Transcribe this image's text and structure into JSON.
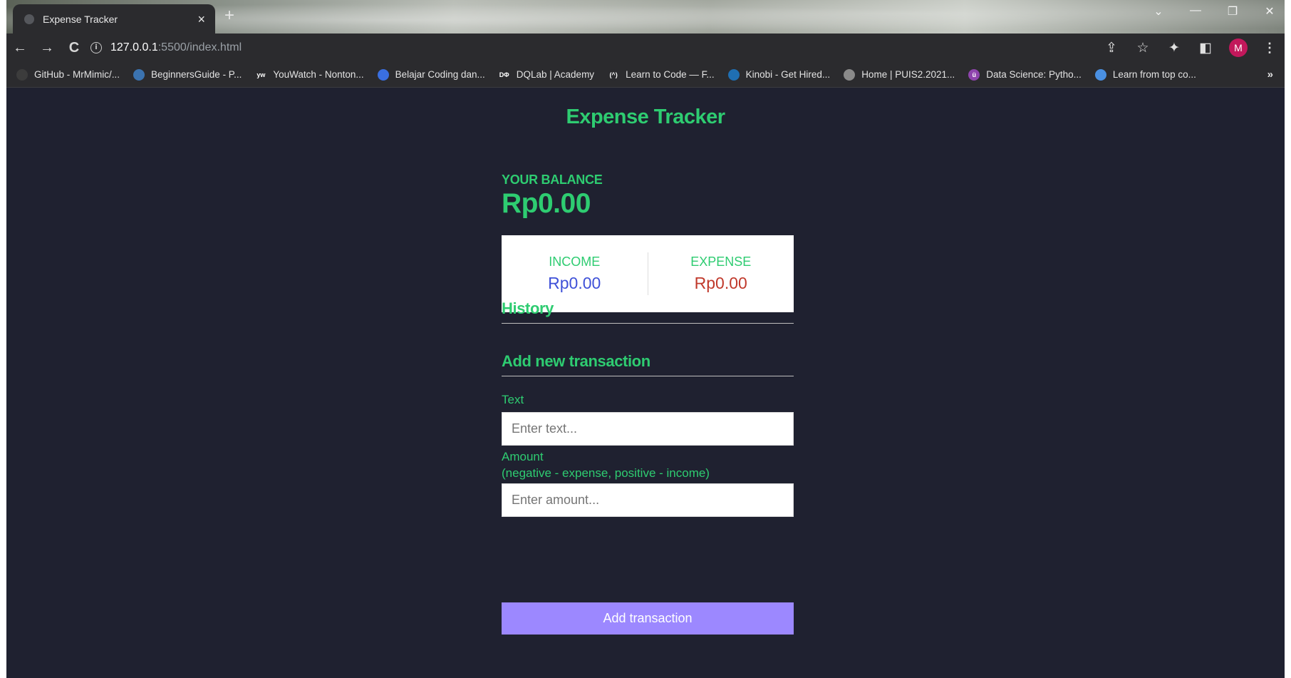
{
  "browser": {
    "tab_title": "Expense Tracker",
    "tab_close": "×",
    "new_tab": "+",
    "url_host": "127.0.0.1",
    "url_path": ":5500/index.html",
    "profile_initial": "M",
    "bookmarks": [
      {
        "label": "GitHub - MrMimic/...",
        "icon": "github-icon",
        "color": "#3c3c3c",
        "glyph": ""
      },
      {
        "label": "BeginnersGuide - P...",
        "icon": "python-icon",
        "color": "#3b73b0",
        "glyph": ""
      },
      {
        "label": "YouWatch - Nonton...",
        "icon": "youwatch-icon",
        "color": "#2b2b2e",
        "glyph": "yw"
      },
      {
        "label": "Belajar Coding dan...",
        "icon": "dicoding-icon",
        "color": "#3a6fe0",
        "glyph": ""
      },
      {
        "label": "DQLab | Academy",
        "icon": "dqlab-icon",
        "color": "#2b2b2e",
        "glyph": "DΦ"
      },
      {
        "label": "Learn to Code — F...",
        "icon": "freecodecamp-icon",
        "color": "#2b2b2e",
        "glyph": "(^)"
      },
      {
        "label": "Kinobi - Get Hired...",
        "icon": "kinobi-icon",
        "color": "#1f6fb2",
        "glyph": ""
      },
      {
        "label": "Home | PUIS2.2021...",
        "icon": "puis-icon",
        "color": "#8a8a8a",
        "glyph": ""
      },
      {
        "label": "Data Science: Pytho...",
        "icon": "udemy-icon",
        "color": "#8e44ad",
        "glyph": "ü"
      },
      {
        "label": "Learn from top co...",
        "icon": "diamond-icon",
        "color": "#4a90e2",
        "glyph": ""
      }
    ],
    "bookmarks_more": "»"
  },
  "app": {
    "title": "Expense Tracker",
    "balance_label": "YOUR BALANCE",
    "balance_value": "Rp0.00",
    "income_label": "INCOME",
    "income_value": "Rp0.00",
    "expense_label": "EXPENSE",
    "expense_value": "Rp0.00",
    "history_title": "History",
    "add_title": "Add new transaction",
    "text_label": "Text",
    "text_placeholder": "Enter text...",
    "amount_label_line1": "Amount",
    "amount_label_line2": "(negative - expense, positive - income)",
    "amount_placeholder": "Enter amount...",
    "submit_label": "Add transaction"
  },
  "colors": {
    "accent_green": "#2ecc71",
    "income_blue": "#3f51d8",
    "expense_red": "#c0392b",
    "button_purple": "#9c88ff",
    "page_bg": "#1f2130"
  }
}
